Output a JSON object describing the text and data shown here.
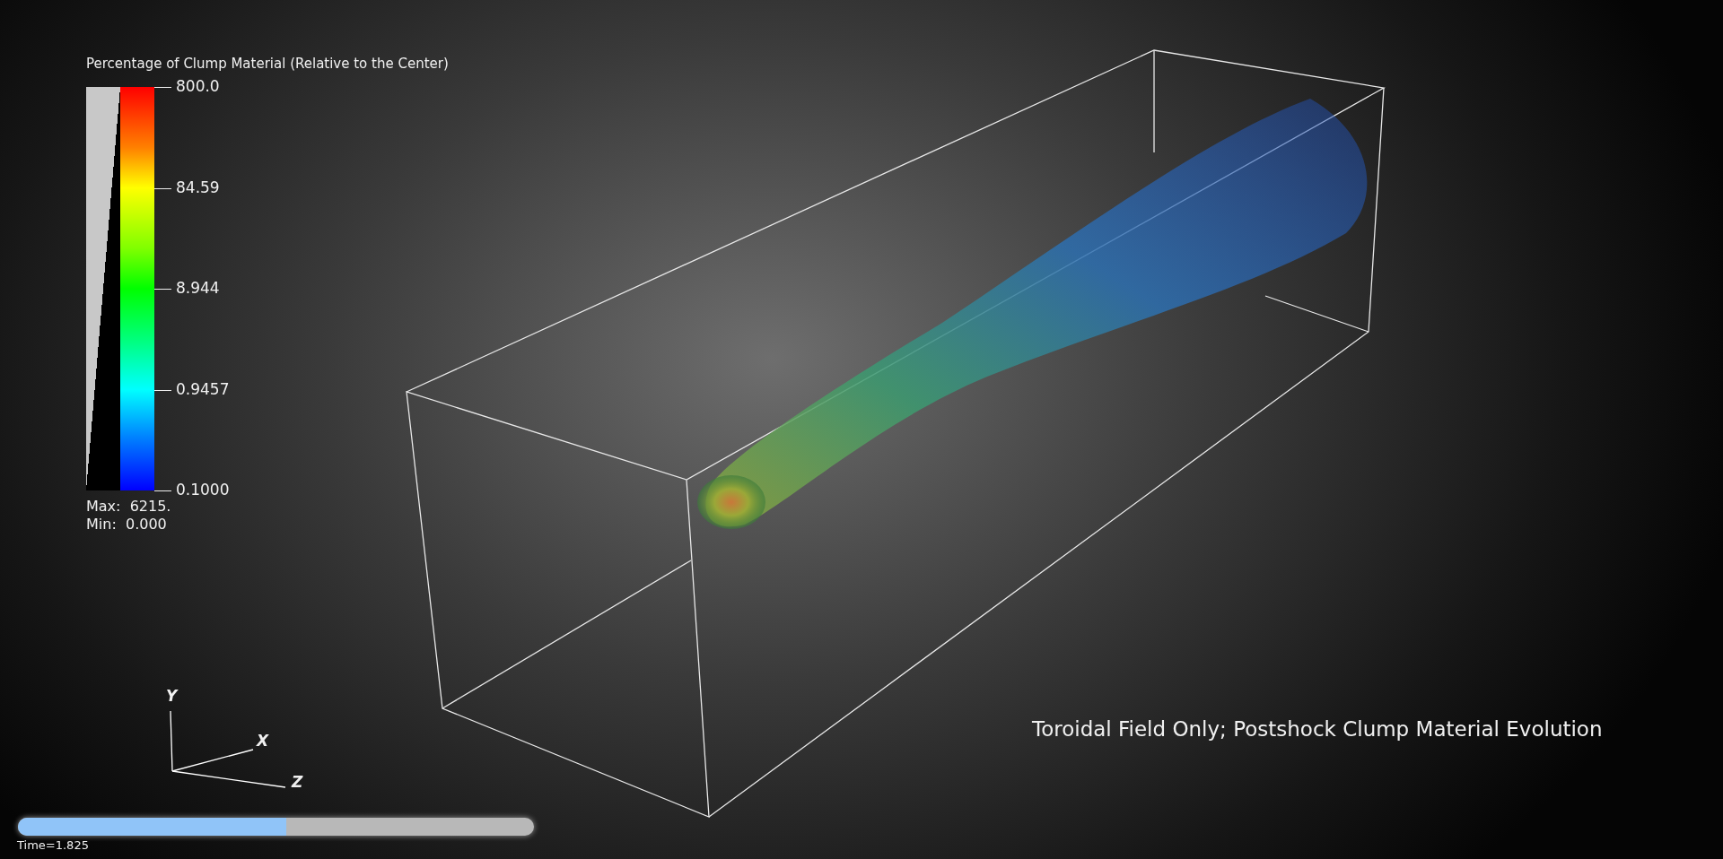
{
  "legend": {
    "title": "Percentage of Clump Material (Relative to the Center)",
    "ticks": [
      "800.0",
      "84.59",
      "8.944",
      "0.9457",
      "0.1000"
    ],
    "max_label": "Max:  6215.",
    "min_label": "Min:  0.000"
  },
  "axes_triad": {
    "y": "Y",
    "x": "X",
    "z": "Z"
  },
  "caption": "Toroidal Field Only; Postshock Clump Material Evolution",
  "time_slider": {
    "level": 0.52,
    "label": "Time=1.825"
  }
}
